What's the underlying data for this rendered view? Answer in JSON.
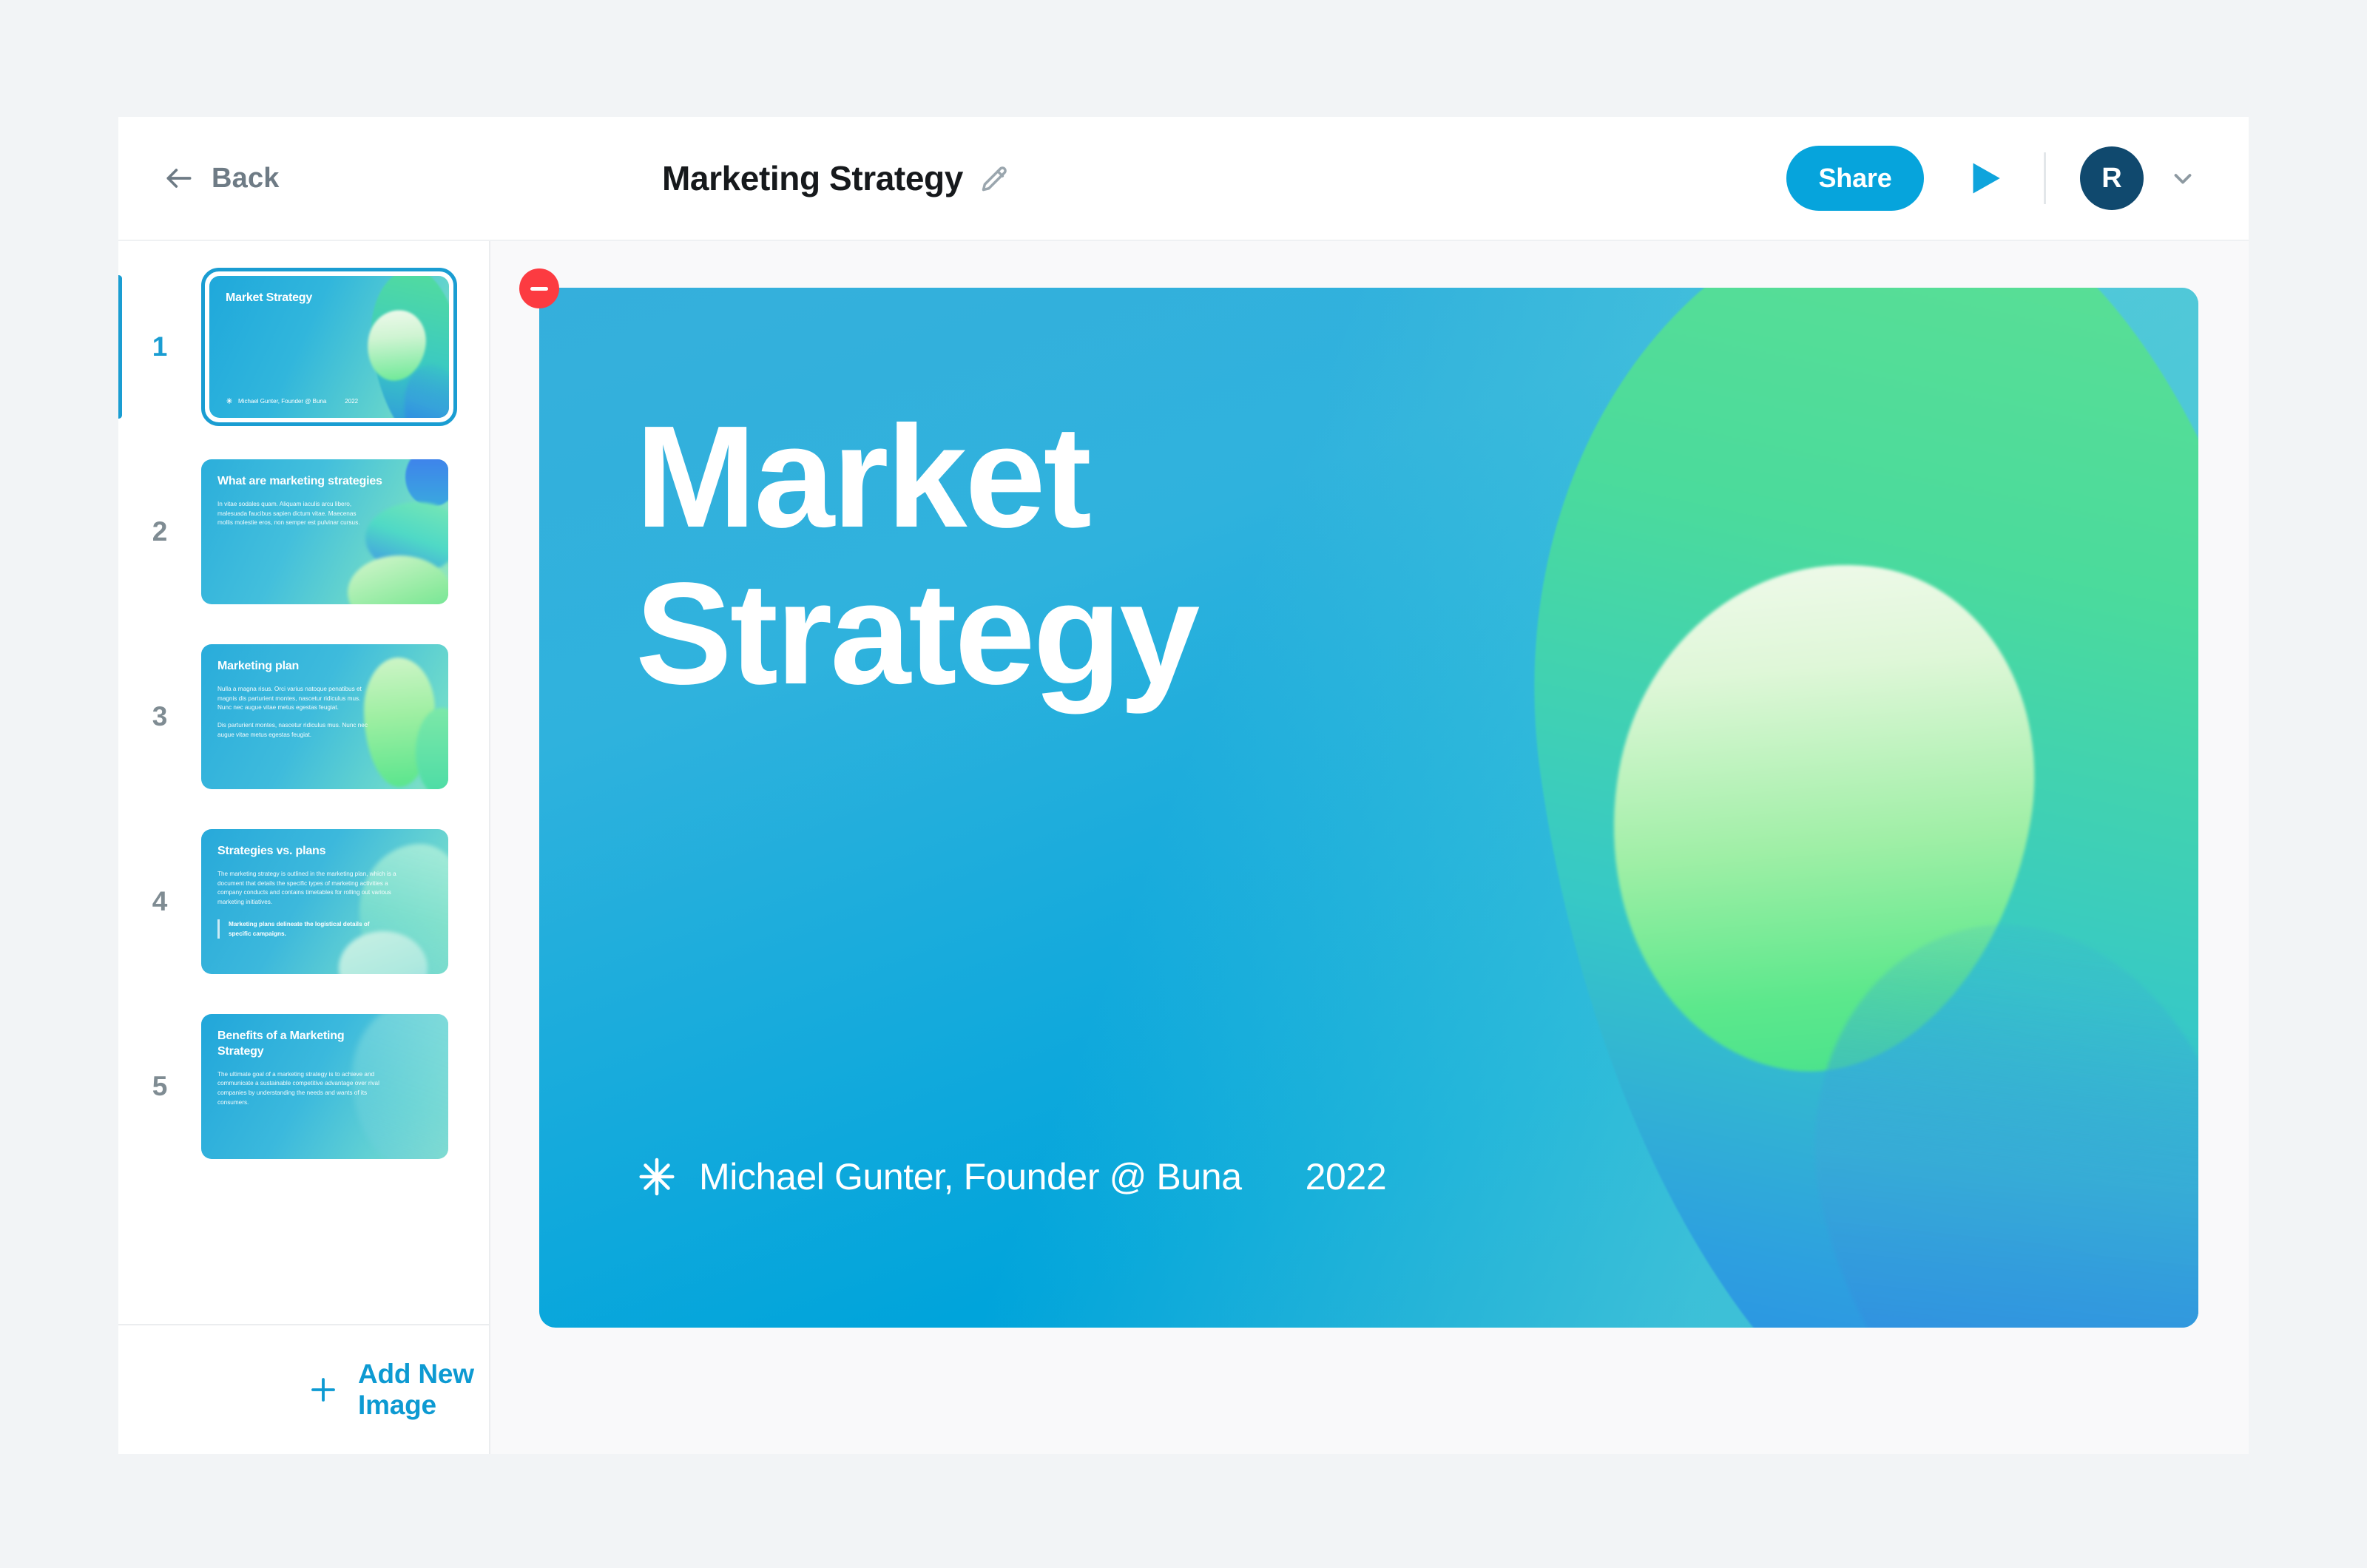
{
  "topbar": {
    "back_label": "Back",
    "doc_title": "Marketing Strategy",
    "edit_icon": "pencil-icon",
    "share_label": "Share",
    "play_icon": "play-icon",
    "avatar_initial": "R",
    "caret_icon": "chevron-down-icon"
  },
  "sidebar": {
    "add_new_label": "Add New Image",
    "plus_icon": "plus-icon",
    "active_index": 1,
    "slides": [
      {
        "number": "1",
        "title": "Market\nStrategy",
        "body": "",
        "body2": "",
        "quote": "",
        "footer_author": "Michael Gunter, Founder @ Buna",
        "footer_year": "2022",
        "active": true
      },
      {
        "number": "2",
        "title": "What are marketing strategies",
        "body": "In vitae sodales quam. Aliquam iaculis arcu libero, malesuada faucibus sapien dictum vitae. Maecenas mollis molestie eros, non semper est pulvinar cursus.",
        "body2": "",
        "quote": "",
        "footer_author": "",
        "footer_year": "",
        "active": false
      },
      {
        "number": "3",
        "title": "Marketing plan",
        "body": "Nulla a magna risus. Orci varius natoque penatibus et magnis dis parturient montes, nascetur ridiculus mus. Nunc nec augue vitae metus egestas feugiat.",
        "body2": "Dis parturient montes, nascetur ridiculus mus. Nunc nec augue vitae metus egestas feugiat.",
        "quote": "",
        "footer_author": "",
        "footer_year": "",
        "active": false
      },
      {
        "number": "4",
        "title": "Strategies vs. plans",
        "body": "The marketing strategy is outlined in the marketing plan, which is a document that details the specific types of marketing activities a company conducts and contains timetables for rolling out various marketing initiatives.",
        "body2": "",
        "quote": "Marketing plans delineate the logistical details of specific campaigns.",
        "footer_author": "",
        "footer_year": "",
        "active": false
      },
      {
        "number": "5",
        "title": "Benefits of a Marketing Strategy",
        "body": "The ultimate goal of a marketing strategy is to achieve and communicate a sustainable competitive advantage over rival companies by understanding the needs and wants of its consumers.",
        "body2": "",
        "quote": "",
        "footer_author": "",
        "footer_year": "",
        "active": false
      }
    ]
  },
  "canvas": {
    "remove_badge_icon": "minus-circle-icon",
    "slide": {
      "title": "Market\nStrategy",
      "asterisk_icon": "asterisk-icon",
      "author": "Michael Gunter, Founder @ Buna",
      "year": "2022"
    }
  },
  "colors": {
    "accent_blue": "#06A4DC",
    "active_blue": "#1A9DD2",
    "avatar_navy": "#10496E",
    "remove_red": "#FC3B41",
    "text_dark": "#16191C",
    "text_muted": "#6E7B85",
    "canvas_bg": "#F9F9FA",
    "page_bg": "#F2F4F6",
    "slide_cyan": "#2FB2DD",
    "slide_blue": "#0098D6",
    "blob_green": "#4BDB9C"
  }
}
